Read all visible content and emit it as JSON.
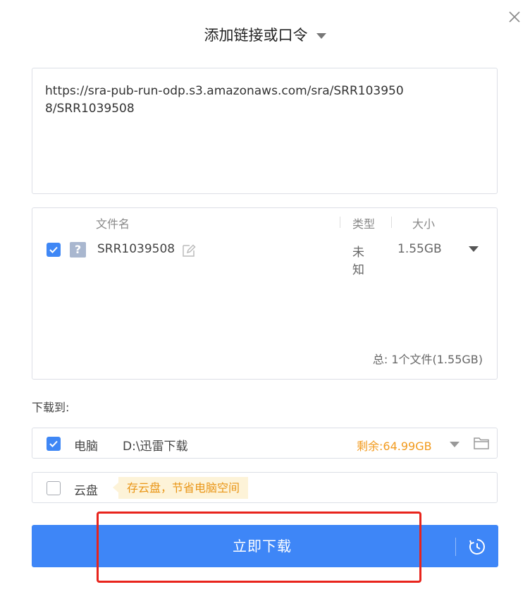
{
  "dialog": {
    "title": "添加链接或口令"
  },
  "url_input": {
    "value": "https://sra-pub-run-odp.s3.amazonaws.com/sra/SRR1039508/SRR1039508"
  },
  "file_table": {
    "columns": {
      "name": "文件名",
      "type": "类型",
      "size": "大小"
    },
    "rows": [
      {
        "checked": true,
        "file_icon": "unknown-file-icon",
        "name": "SRR1039508",
        "type": "未知",
        "size": "1.55GB"
      }
    ],
    "total": "总:  1个文件(1.55GB)"
  },
  "download_to": {
    "label": "下载到:",
    "pc": {
      "checked": true,
      "label": "电脑",
      "path": "D:\\迅雷下载",
      "remaining": "剩余:64.99GB"
    },
    "cloud": {
      "checked": false,
      "label": "云盘",
      "tip": "存云盘，节省电脑空间"
    }
  },
  "primary_button": {
    "label": "立即下载"
  },
  "colors": {
    "accent": "#3e86f7",
    "warning": "#f29a1d",
    "highlight": "#e8241c"
  }
}
